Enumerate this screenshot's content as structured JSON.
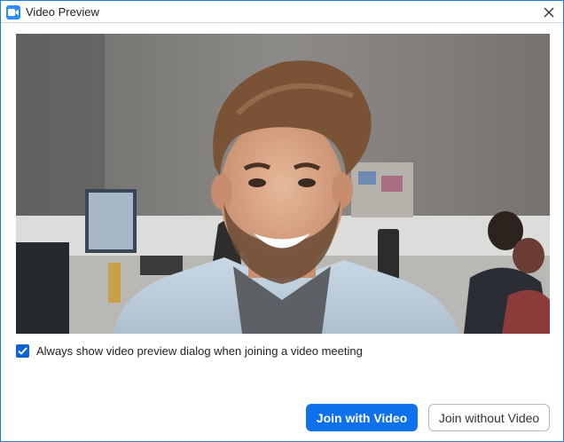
{
  "window": {
    "title": "Video Preview",
    "accent_color": "#1f7ad6",
    "icon": "zoom-video-camera-icon"
  },
  "titlebar": {
    "close_icon": "close-icon"
  },
  "preview": {
    "content": "camera-feed-image"
  },
  "options": {
    "always_show_preview_label": "Always show video preview dialog when joining a video meeting",
    "always_show_preview_checked": true
  },
  "actions": {
    "join_with_video_label": "Join with Video",
    "join_without_video_label": "Join without Video",
    "primary_color": "#0e71eb"
  }
}
